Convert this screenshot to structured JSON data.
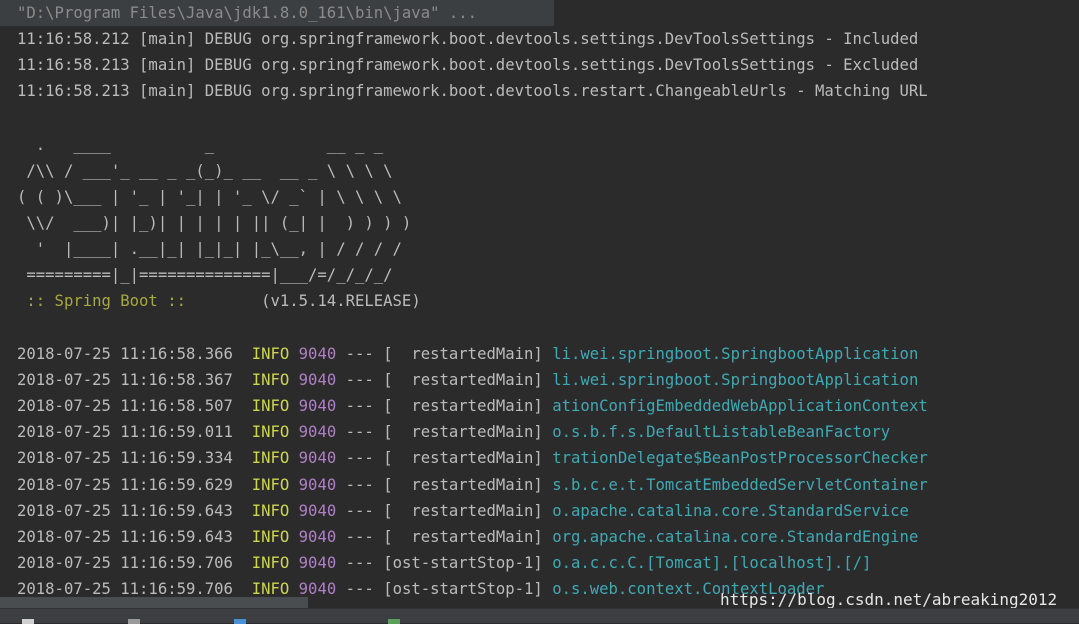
{
  "command": "\"D:\\Program Files\\Java\\jdk1.8.0_161\\bin\\java\" ...",
  "debug_lines": [
    "11:16:58.212 [main] DEBUG org.springframework.boot.devtools.settings.DevToolsSettings - Included",
    "11:16:58.213 [main] DEBUG org.springframework.boot.devtools.settings.DevToolsSettings - Excluded",
    "11:16:58.213 [main] DEBUG org.springframework.boot.devtools.restart.ChangeableUrls - Matching URL"
  ],
  "banner": [
    "  .   ____          _            __ _ _",
    " /\\\\ / ___'_ __ _ _(_)_ __  __ _ \\ \\ \\ \\",
    "( ( )\\___ | '_ | '_| | '_ \\/ _` | \\ \\ \\ \\",
    " \\\\/  ___)| |_)| | | | | || (_| |  ) ) ) )",
    "  '  |____| .__|_| |_|_| |_\\__, | / / / /",
    " =========|_|==============|___/=/_/_/_/"
  ],
  "spring_label": " :: Spring Boot :: ",
  "spring_version": "       (v1.5.14.RELEASE)",
  "log_rows": [
    {
      "timestamp": "2018-07-25 11:16:58.366",
      "level": "INFO",
      "pid": "9040",
      "sep": "---",
      "thread": "[  restartedMain]",
      "logger": "li.wei.springboot.SpringbootApplication"
    },
    {
      "timestamp": "2018-07-25 11:16:58.367",
      "level": "INFO",
      "pid": "9040",
      "sep": "---",
      "thread": "[  restartedMain]",
      "logger": "li.wei.springboot.SpringbootApplication"
    },
    {
      "timestamp": "2018-07-25 11:16:58.507",
      "level": "INFO",
      "pid": "9040",
      "sep": "---",
      "thread": "[  restartedMain]",
      "logger": "ationConfigEmbeddedWebApplicationContext"
    },
    {
      "timestamp": "2018-07-25 11:16:59.011",
      "level": "INFO",
      "pid": "9040",
      "sep": "---",
      "thread": "[  restartedMain]",
      "logger": "o.s.b.f.s.DefaultListableBeanFactory"
    },
    {
      "timestamp": "2018-07-25 11:16:59.334",
      "level": "INFO",
      "pid": "9040",
      "sep": "---",
      "thread": "[  restartedMain]",
      "logger": "trationDelegate$BeanPostProcessorChecker"
    },
    {
      "timestamp": "2018-07-25 11:16:59.629",
      "level": "INFO",
      "pid": "9040",
      "sep": "---",
      "thread": "[  restartedMain]",
      "logger": "s.b.c.e.t.TomcatEmbeddedServletContainer"
    },
    {
      "timestamp": "2018-07-25 11:16:59.643",
      "level": "INFO",
      "pid": "9040",
      "sep": "---",
      "thread": "[  restartedMain]",
      "logger": "o.apache.catalina.core.StandardService"
    },
    {
      "timestamp": "2018-07-25 11:16:59.643",
      "level": "INFO",
      "pid": "9040",
      "sep": "---",
      "thread": "[  restartedMain]",
      "logger": "org.apache.catalina.core.StandardEngine"
    },
    {
      "timestamp": "2018-07-25 11:16:59.706",
      "level": "INFO",
      "pid": "9040",
      "sep": "---",
      "thread": "[ost-startStop-1]",
      "logger": "o.a.c.c.C.[Tomcat].[localhost].[/]"
    },
    {
      "timestamp": "2018-07-25 11:16:59.706",
      "level": "INFO",
      "pid": "9040",
      "sep": "---",
      "thread": "[ost-startStop-1]",
      "logger": "o.s.web.context.ContextLoader"
    }
  ],
  "watermark": "https://blog.csdn.net/abreaking2012",
  "colors": {
    "background": "#2b2b2b",
    "text": "#bbbbbb",
    "info": "#cdd54f",
    "pid": "#b080c5",
    "logger": "#3fa9b5",
    "spring": "#a8a842"
  }
}
